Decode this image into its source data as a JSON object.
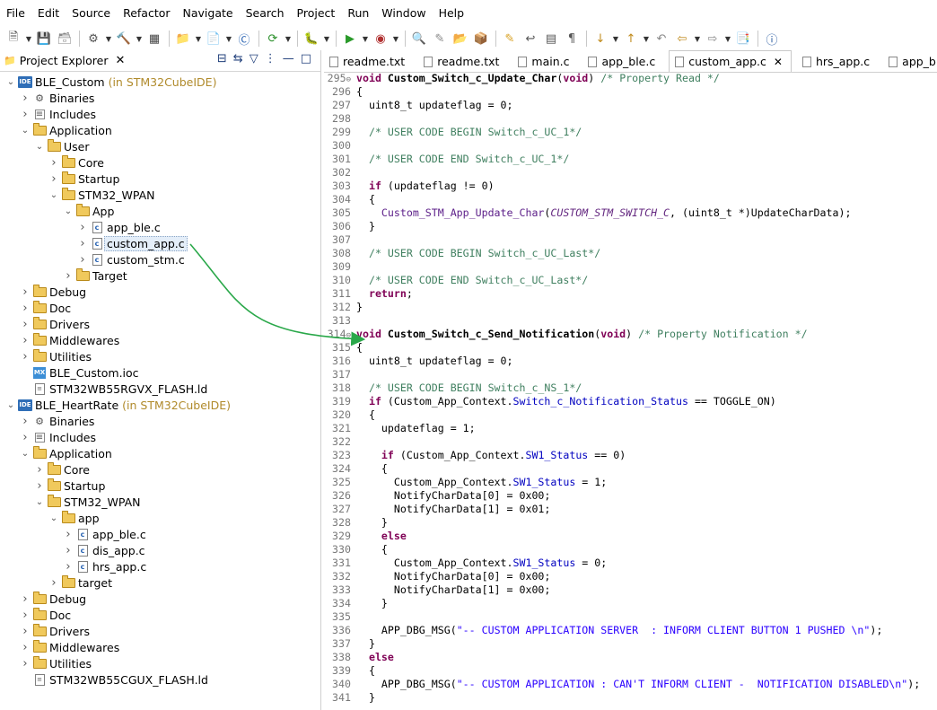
{
  "menu": [
    "File",
    "Edit",
    "Source",
    "Refactor",
    "Navigate",
    "Search",
    "Project",
    "Run",
    "Window",
    "Help"
  ],
  "toolbar_icons": [
    "new-icon",
    "save-icon",
    "save-all-icon",
    "build-settings-icon",
    "hammer-icon",
    "binary-icon",
    "new-project-icon",
    "new-source-icon",
    "new-class-icon",
    "refresh-icon",
    "debug-icon",
    "run-icon",
    "external-tools-icon",
    "search-icon",
    "mark-icon",
    "open-type-icon",
    "open-element-icon",
    "highlight-icon",
    "toggle-word-wrap-icon",
    "block-selection-icon",
    "show-whitespace-icon",
    "next-annotation-icon",
    "previous-annotation-icon",
    "last-edit-icon",
    "back-icon",
    "forward-icon",
    "perspective-icon",
    "info-icon"
  ],
  "explorer": {
    "title": "Project Explorer",
    "tree": [
      {
        "d": 0,
        "t": "v",
        "icon": "ide",
        "label": "BLE_Custom",
        "extra": "(in STM32CubeIDE)"
      },
      {
        "d": 1,
        "t": ">",
        "icon": "bin",
        "label": "Binaries"
      },
      {
        "d": 1,
        "t": ">",
        "icon": "inc",
        "label": "Includes"
      },
      {
        "d": 1,
        "t": "v",
        "icon": "folder",
        "label": "Application"
      },
      {
        "d": 2,
        "t": "v",
        "icon": "folder",
        "label": "User"
      },
      {
        "d": 3,
        "t": ">",
        "icon": "folder",
        "label": "Core"
      },
      {
        "d": 3,
        "t": ">",
        "icon": "folder",
        "label": "Startup"
      },
      {
        "d": 3,
        "t": "v",
        "icon": "folder",
        "label": "STM32_WPAN"
      },
      {
        "d": 4,
        "t": "v",
        "icon": "folder",
        "label": "App"
      },
      {
        "d": 5,
        "t": ">",
        "icon": "c",
        "label": "app_ble.c"
      },
      {
        "d": 5,
        "t": ">",
        "icon": "c",
        "label": "custom_app.c",
        "sel": true
      },
      {
        "d": 5,
        "t": ">",
        "icon": "c",
        "label": "custom_stm.c"
      },
      {
        "d": 4,
        "t": ">",
        "icon": "folder",
        "label": "Target"
      },
      {
        "d": 1,
        "t": ">",
        "icon": "folder",
        "label": "Debug"
      },
      {
        "d": 1,
        "t": ">",
        "icon": "folder",
        "label": "Doc"
      },
      {
        "d": 1,
        "t": ">",
        "icon": "folder",
        "label": "Drivers"
      },
      {
        "d": 1,
        "t": ">",
        "icon": "folder",
        "label": "Middlewares"
      },
      {
        "d": 1,
        "t": ">",
        "icon": "folder",
        "label": "Utilities"
      },
      {
        "d": 1,
        "t": "",
        "icon": "mx",
        "label": "BLE_Custom.ioc"
      },
      {
        "d": 1,
        "t": "",
        "icon": "ld",
        "label": "STM32WB55RGVX_FLASH.ld"
      },
      {
        "d": 0,
        "t": "v",
        "icon": "ide",
        "label": "BLE_HeartRate",
        "extra": "(in STM32CubeIDE)"
      },
      {
        "d": 1,
        "t": ">",
        "icon": "bin",
        "label": "Binaries"
      },
      {
        "d": 1,
        "t": ">",
        "icon": "inc",
        "label": "Includes"
      },
      {
        "d": 1,
        "t": "v",
        "icon": "folder",
        "label": "Application"
      },
      {
        "d": 2,
        "t": ">",
        "icon": "folder",
        "label": "Core"
      },
      {
        "d": 2,
        "t": ">",
        "icon": "folder",
        "label": "Startup"
      },
      {
        "d": 2,
        "t": "v",
        "icon": "folder",
        "label": "STM32_WPAN"
      },
      {
        "d": 3,
        "t": "v",
        "icon": "folder",
        "label": "app"
      },
      {
        "d": 4,
        "t": ">",
        "icon": "c",
        "label": "app_ble.c"
      },
      {
        "d": 4,
        "t": ">",
        "icon": "c",
        "label": "dis_app.c"
      },
      {
        "d": 4,
        "t": ">",
        "icon": "c",
        "label": "hrs_app.c"
      },
      {
        "d": 3,
        "t": ">",
        "icon": "folder",
        "label": "target"
      },
      {
        "d": 1,
        "t": ">",
        "icon": "folder",
        "label": "Debug"
      },
      {
        "d": 1,
        "t": ">",
        "icon": "folder",
        "label": "Doc"
      },
      {
        "d": 1,
        "t": ">",
        "icon": "folder",
        "label": "Drivers"
      },
      {
        "d": 1,
        "t": ">",
        "icon": "folder",
        "label": "Middlewares"
      },
      {
        "d": 1,
        "t": ">",
        "icon": "folder",
        "label": "Utilities"
      },
      {
        "d": 1,
        "t": "",
        "icon": "ld",
        "label": "STM32WB55CGUX_FLASH.ld"
      }
    ]
  },
  "editor_tabs": [
    {
      "label": "readme.txt"
    },
    {
      "label": "readme.txt"
    },
    {
      "label": "main.c"
    },
    {
      "label": "app_ble.c"
    },
    {
      "label": "custom_app.c",
      "active": true
    },
    {
      "label": "hrs_app.c"
    },
    {
      "label": "app_ble"
    }
  ],
  "code": [
    {
      "n": "295",
      "fold": true,
      "s": [
        [
          "kw",
          "void "
        ],
        [
          "fn",
          "Custom_Switch_c_Update_Char"
        ],
        [
          "ct",
          "("
        ],
        [
          "kw",
          "void"
        ],
        [
          "ct",
          ") "
        ],
        [
          "cm",
          "/* Property Read */"
        ]
      ]
    },
    {
      "n": "296",
      "s": [
        [
          "ct",
          "{"
        ]
      ]
    },
    {
      "n": "297",
      "s": [
        [
          "ct",
          "  uint8_t updateflag = 0;"
        ]
      ]
    },
    {
      "n": "298",
      "s": []
    },
    {
      "n": "299",
      "s": [
        [
          "cm",
          "  /* USER CODE BEGIN Switch_c_UC_1*/"
        ]
      ]
    },
    {
      "n": "300",
      "s": []
    },
    {
      "n": "301",
      "s": [
        [
          "cm",
          "  /* USER CODE END Switch_c_UC_1*/"
        ]
      ]
    },
    {
      "n": "302",
      "s": []
    },
    {
      "n": "303",
      "s": [
        [
          "kw",
          "  if "
        ],
        [
          "ct",
          "(updateflag != 0)"
        ]
      ]
    },
    {
      "n": "304",
      "s": [
        [
          "ct",
          "  {"
        ]
      ]
    },
    {
      "n": "305",
      "s": [
        [
          "fo",
          "    Custom_STM_App_Update_Char"
        ],
        [
          "ct",
          "("
        ],
        [
          "mc",
          "CUSTOM_STM_SWITCH_C"
        ],
        [
          "ct",
          ", (uint8_t *)UpdateCharData);"
        ]
      ]
    },
    {
      "n": "306",
      "s": [
        [
          "ct",
          "  }"
        ]
      ]
    },
    {
      "n": "307",
      "s": []
    },
    {
      "n": "308",
      "s": [
        [
          "cm",
          "  /* USER CODE BEGIN Switch_c_UC_Last*/"
        ]
      ]
    },
    {
      "n": "309",
      "s": []
    },
    {
      "n": "310",
      "s": [
        [
          "cm",
          "  /* USER CODE END Switch_c_UC_Last*/"
        ]
      ]
    },
    {
      "n": "311",
      "s": [
        [
          "kw",
          "  return"
        ],
        [
          "ct",
          ";"
        ]
      ]
    },
    {
      "n": "312",
      "s": [
        [
          "ct",
          "}"
        ]
      ]
    },
    {
      "n": "313",
      "s": []
    },
    {
      "n": "314",
      "fold": true,
      "s": [
        [
          "kw",
          "void "
        ],
        [
          "fn",
          "Custom_Switch_c_Send_Notification"
        ],
        [
          "ct",
          "("
        ],
        [
          "kw",
          "void"
        ],
        [
          "ct",
          ") "
        ],
        [
          "cm",
          "/* Property Notification */"
        ]
      ]
    },
    {
      "n": "315",
      "s": [
        [
          "ct",
          "{"
        ]
      ]
    },
    {
      "n": "316",
      "s": [
        [
          "ct",
          "  uint8_t updateflag = 0;"
        ]
      ]
    },
    {
      "n": "317",
      "s": []
    },
    {
      "n": "318",
      "s": [
        [
          "cm",
          "  /* USER CODE BEGIN Switch_c_NS_1*/"
        ]
      ]
    },
    {
      "n": "319",
      "s": [
        [
          "kw",
          "  if "
        ],
        [
          "ct",
          "(Custom_App_Context."
        ],
        [
          "fl",
          "Switch_c_Notification_Status"
        ],
        [
          "ct",
          " == TOGGLE_ON)"
        ]
      ]
    },
    {
      "n": "320",
      "s": [
        [
          "ct",
          "  {"
        ]
      ]
    },
    {
      "n": "321",
      "s": [
        [
          "ct",
          "    updateflag = 1;"
        ]
      ]
    },
    {
      "n": "322",
      "s": []
    },
    {
      "n": "323",
      "s": [
        [
          "kw",
          "    if "
        ],
        [
          "ct",
          "(Custom_App_Context."
        ],
        [
          "fl",
          "SW1_Status"
        ],
        [
          "ct",
          " == 0)"
        ]
      ]
    },
    {
      "n": "324",
      "s": [
        [
          "ct",
          "    {"
        ]
      ]
    },
    {
      "n": "325",
      "s": [
        [
          "ct",
          "      Custom_App_Context."
        ],
        [
          "fl",
          "SW1_Status"
        ],
        [
          "ct",
          " = 1;"
        ]
      ]
    },
    {
      "n": "326",
      "s": [
        [
          "ct",
          "      NotifyCharData[0] = 0x00;"
        ]
      ]
    },
    {
      "n": "327",
      "s": [
        [
          "ct",
          "      NotifyCharData[1] = 0x01;"
        ]
      ]
    },
    {
      "n": "328",
      "s": [
        [
          "ct",
          "    }"
        ]
      ]
    },
    {
      "n": "329",
      "s": [
        [
          "kw",
          "    else"
        ]
      ]
    },
    {
      "n": "330",
      "s": [
        [
          "ct",
          "    {"
        ]
      ]
    },
    {
      "n": "331",
      "s": [
        [
          "ct",
          "      Custom_App_Context."
        ],
        [
          "fl",
          "SW1_Status"
        ],
        [
          "ct",
          " = 0;"
        ]
      ]
    },
    {
      "n": "332",
      "s": [
        [
          "ct",
          "      NotifyCharData[0] = 0x00;"
        ]
      ]
    },
    {
      "n": "333",
      "s": [
        [
          "ct",
          "      NotifyCharData[1] = 0x00;"
        ]
      ]
    },
    {
      "n": "334",
      "s": [
        [
          "ct",
          "    }"
        ]
      ]
    },
    {
      "n": "335",
      "s": []
    },
    {
      "n": "336",
      "s": [
        [
          "ct",
          "    APP_DBG_MSG("
        ],
        [
          "st",
          "\"-- CUSTOM APPLICATION SERVER  : INFORM CLIENT BUTTON 1 PUSHED \\n\""
        ],
        [
          "ct",
          ");"
        ]
      ]
    },
    {
      "n": "337",
      "s": [
        [
          "ct",
          "  }"
        ]
      ]
    },
    {
      "n": "338",
      "s": [
        [
          "kw",
          "  else"
        ]
      ]
    },
    {
      "n": "339",
      "s": [
        [
          "ct",
          "  {"
        ]
      ]
    },
    {
      "n": "340",
      "s": [
        [
          "ct",
          "    APP_DBG_MSG("
        ],
        [
          "st",
          "\"-- CUSTOM APPLICATION : CAN'T INFORM CLIENT -  NOTIFICATION DISABLED\\n\""
        ],
        [
          "ct",
          ");"
        ]
      ]
    },
    {
      "n": "341",
      "s": [
        [
          "ct",
          "  }"
        ]
      ]
    }
  ],
  "arrow_color": "#2aa84a"
}
